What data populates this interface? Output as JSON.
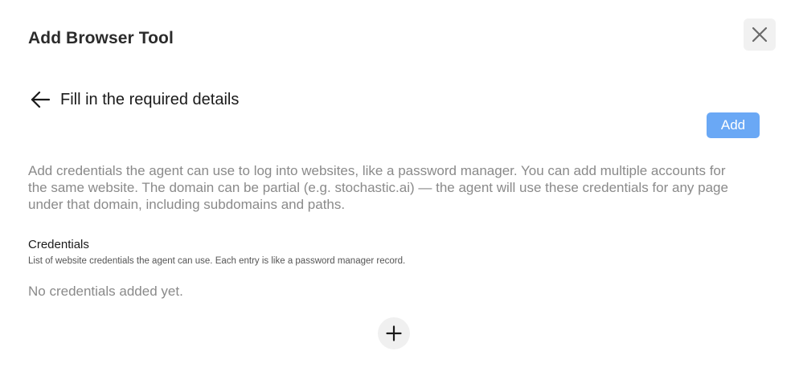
{
  "dialog": {
    "title": "Add Browser Tool",
    "close_icon": "close-icon"
  },
  "step": {
    "back_icon": "arrow-left-icon",
    "title": "Fill in the required details"
  },
  "actions": {
    "add_label": "Add",
    "add_color": "#6aa8f5"
  },
  "description": "Add credentials the agent can use to log into websites, like a password manager. You can add multiple accounts for the same website. The domain can be partial (e.g. stochastic.ai) — the agent will use these credentials for any page under that domain, including subdomains and paths.",
  "credentials": {
    "label": "Credentials",
    "help": "List of website credentials the agent can use. Each entry is like a password manager record.",
    "empty_text": "No credentials added yet.",
    "add_icon": "plus-icon"
  }
}
